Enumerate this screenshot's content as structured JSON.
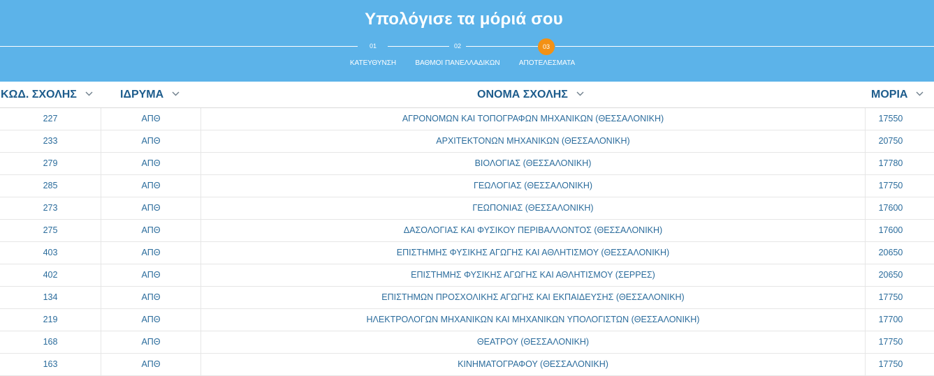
{
  "header": {
    "title": "Υπολόγισε τα μόριά σου",
    "steps": [
      {
        "num": "01",
        "label": "ΚΑΤΕΥΘΥΝΣΗ"
      },
      {
        "num": "02",
        "label": "ΒΑΘΜΟΙ ΠΑΝΕΛΛΑΔΙΚΩΝ"
      },
      {
        "num": "03",
        "label": "ΑΠΟΤΕΛΕΣΜΑΤΑ",
        "active": true
      }
    ],
    "active_color": "#f39114",
    "background_color": "#5cb3e9"
  },
  "table": {
    "columns": [
      {
        "label": "ΚΩΔ. ΣΧΟΛΗΣ",
        "icon": "chevron-down-icon"
      },
      {
        "label": "ΙΔΡΥΜΑ",
        "icon": "chevron-down-icon"
      },
      {
        "label": "ΟΝΟΜΑ ΣΧΟΛΗΣ",
        "icon": "chevron-down-icon"
      },
      {
        "label": "ΜΟΡΙΑ",
        "icon": "chevron-down-icon"
      }
    ],
    "rows": [
      {
        "code": "227",
        "institution": "ΑΠΘ",
        "name": "ΑΓΡΟΝΟΜΩΝ ΚΑΙ ΤΟΠΟΓΡΑΦΩΝ ΜΗΧΑΝΙΚΩΝ (ΘΕΣΣΑΛΟΝΙΚΗ)",
        "points": "17550"
      },
      {
        "code": "233",
        "institution": "ΑΠΘ",
        "name": "ΑΡΧΙΤΕΚΤΟΝΩΝ ΜΗΧΑΝΙΚΩΝ (ΘΕΣΣΑΛΟΝΙΚΗ)",
        "points": "20750"
      },
      {
        "code": "279",
        "institution": "ΑΠΘ",
        "name": "ΒΙΟΛΟΓΙΑΣ (ΘΕΣΣΑΛΟΝΙΚΗ)",
        "points": "17780"
      },
      {
        "code": "285",
        "institution": "ΑΠΘ",
        "name": "ΓΕΩΛΟΓΙΑΣ (ΘΕΣΣΑΛΟΝΙΚΗ)",
        "points": "17750"
      },
      {
        "code": "273",
        "institution": "ΑΠΘ",
        "name": "ΓΕΩΠΟΝΙΑΣ (ΘΕΣΣΑΛΟΝΙΚΗ)",
        "points": "17600"
      },
      {
        "code": "275",
        "institution": "ΑΠΘ",
        "name": "ΔΑΣΟΛΟΓΙΑΣ ΚΑΙ ΦΥΣΙΚΟΥ ΠΕΡΙΒΑΛΛΟΝΤΟΣ (ΘΕΣΣΑΛΟΝΙΚΗ)",
        "points": "17600"
      },
      {
        "code": "403",
        "institution": "ΑΠΘ",
        "name": "ΕΠΙΣΤΗΜΗΣ ΦΥΣΙΚΗΣ ΑΓΩΓΗΣ ΚΑΙ ΑΘΛΗΤΙΣΜΟΥ (ΘΕΣΣΑΛΟΝΙΚΗ)",
        "points": "20650"
      },
      {
        "code": "402",
        "institution": "ΑΠΘ",
        "name": "ΕΠΙΣΤΗΜΗΣ ΦΥΣΙΚΗΣ ΑΓΩΓΗΣ ΚΑΙ ΑΘΛΗΤΙΣΜΟΥ (ΣΕΡΡΕΣ)",
        "points": "20650"
      },
      {
        "code": "134",
        "institution": "ΑΠΘ",
        "name": "ΕΠΙΣΤΗΜΩΝ ΠΡΟΣΧΟΛΙΚΗΣ ΑΓΩΓΗΣ ΚΑΙ ΕΚΠΑΙΔΕΥΣΗΣ (ΘΕΣΣΑΛΟΝΙΚΗ)",
        "points": "17750"
      },
      {
        "code": "219",
        "institution": "ΑΠΘ",
        "name": "ΗΛΕΚΤΡΟΛΟΓΩΝ ΜΗΧΑΝΙΚΩΝ ΚΑΙ ΜΗΧΑΝΙΚΩΝ ΥΠΟΛΟΓΙΣΤΩΝ (ΘΕΣΣΑΛΟΝΙΚΗ)",
        "points": "17700"
      },
      {
        "code": "168",
        "institution": "ΑΠΘ",
        "name": "ΘΕΑΤΡΟΥ (ΘΕΣΣΑΛΟΝΙΚΗ)",
        "points": "17750"
      },
      {
        "code": "163",
        "institution": "ΑΠΘ",
        "name": "ΚΙΝΗΜΑΤΟΓΡΑΦΟΥ (ΘΕΣΣΑΛΟΝΙΚΗ)",
        "points": "17750"
      }
    ]
  }
}
